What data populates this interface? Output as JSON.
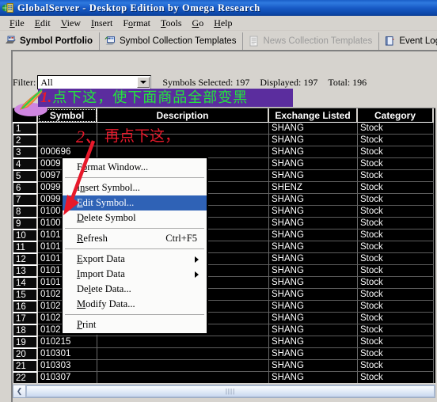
{
  "window": {
    "title": "GlobalServer - Desktop Edition by Omega Research",
    "icon": "application-icon"
  },
  "menubar": {
    "items": [
      {
        "label": "File",
        "accel": "F"
      },
      {
        "label": "Edit",
        "accel": "E"
      },
      {
        "label": "View",
        "accel": "V"
      },
      {
        "label": "Insert",
        "accel": "I"
      },
      {
        "label": "Format",
        "accel": "o"
      },
      {
        "label": "Tools",
        "accel": "T"
      },
      {
        "label": "Go",
        "accel": "G"
      },
      {
        "label": "Help",
        "accel": "H"
      }
    ]
  },
  "tabs": [
    {
      "label": "Symbol Portfolio",
      "icon": "portfolio-icon",
      "active": true,
      "disabled": false
    },
    {
      "label": "Symbol Collection Templates",
      "icon": "symbol-template-icon",
      "active": false,
      "disabled": false
    },
    {
      "label": "News Collection Templates",
      "icon": "news-template-icon",
      "active": false,
      "disabled": true
    },
    {
      "label": "Event Log",
      "icon": "event-log-icon",
      "active": false,
      "disabled": false
    }
  ],
  "filterbar": {
    "label": "Filter:",
    "combo_value": "All",
    "combo_placeholder": "All",
    "dropdown_icon": "chevron-down-icon",
    "stats": [
      "Symbols  Selected: 197",
      "Displayed: 197",
      "Total: 196"
    ]
  },
  "grid": {
    "columns": [
      "Symbol",
      "Description",
      "Exchange Listed",
      "Category"
    ],
    "rows": [
      {
        "n": "1",
        "symbol": "",
        "description": "",
        "exchange": "SHANG",
        "category": "Stock"
      },
      {
        "n": "2",
        "symbol": "",
        "description": "",
        "exchange": "SHANG",
        "category": "Stock"
      },
      {
        "n": "3",
        "symbol": "000696",
        "description": "",
        "exchange": "SHANG",
        "category": "Stock"
      },
      {
        "n": "4",
        "symbol": "0009",
        "description": "",
        "exchange": "SHANG",
        "category": "Stock"
      },
      {
        "n": "5",
        "symbol": "0097",
        "description": "",
        "exchange": "SHANG",
        "category": "Stock"
      },
      {
        "n": "6",
        "symbol": "0099",
        "description": "",
        "exchange": "SHENZ",
        "category": "Stock"
      },
      {
        "n": "7",
        "symbol": "0099",
        "description": "",
        "exchange": "SHANG",
        "category": "Stock"
      },
      {
        "n": "8",
        "symbol": "0100",
        "description": "",
        "exchange": "SHANG",
        "category": "Stock"
      },
      {
        "n": "9",
        "symbol": "0100",
        "description": "",
        "exchange": "SHANG",
        "category": "Stock"
      },
      {
        "n": "10",
        "symbol": "0101",
        "description": "",
        "exchange": "SHANG",
        "category": "Stock"
      },
      {
        "n": "11",
        "symbol": "0101",
        "description": "",
        "exchange": "SHANG",
        "category": "Stock"
      },
      {
        "n": "12",
        "symbol": "0101",
        "description": "",
        "exchange": "SHANG",
        "category": "Stock"
      },
      {
        "n": "13",
        "symbol": "0101",
        "description": "",
        "exchange": "SHANG",
        "category": "Stock"
      },
      {
        "n": "14",
        "symbol": "0101",
        "description": "",
        "exchange": "SHANG",
        "category": "Stock"
      },
      {
        "n": "15",
        "symbol": "0102",
        "description": "",
        "exchange": "SHANG",
        "category": "Stock"
      },
      {
        "n": "16",
        "symbol": "0102",
        "description": "",
        "exchange": "SHANG",
        "category": "Stock"
      },
      {
        "n": "17",
        "symbol": "0102",
        "description": "",
        "exchange": "SHANG",
        "category": "Stock"
      },
      {
        "n": "18",
        "symbol": "0102",
        "description": "",
        "exchange": "SHANG",
        "category": "Stock"
      },
      {
        "n": "19",
        "symbol": "010215",
        "description": "",
        "exchange": "SHANG",
        "category": "Stock"
      },
      {
        "n": "20",
        "symbol": "010301",
        "description": "",
        "exchange": "SHANG",
        "category": "Stock"
      },
      {
        "n": "21",
        "symbol": "010303",
        "description": "",
        "exchange": "SHANG",
        "category": "Stock"
      },
      {
        "n": "22",
        "symbol": "010307",
        "description": "",
        "exchange": "SHANG",
        "category": "Stock"
      }
    ]
  },
  "context_menu": {
    "items": [
      {
        "kind": "item",
        "label": "Format Window...",
        "accel_char": "o",
        "shortcut": "",
        "submenu": false,
        "selected": false
      },
      {
        "kind": "separator"
      },
      {
        "kind": "item",
        "label": "Insert Symbol...",
        "accel_char": "n",
        "shortcut": "",
        "submenu": false,
        "selected": false
      },
      {
        "kind": "item",
        "label": "Edit Symbol...",
        "accel_char": "E",
        "shortcut": "",
        "submenu": false,
        "selected": true
      },
      {
        "kind": "item",
        "label": "Delete Symbol",
        "accel_char": "D",
        "shortcut": "",
        "submenu": false,
        "selected": false
      },
      {
        "kind": "separator"
      },
      {
        "kind": "item",
        "label": "Refresh",
        "accel_char": "R",
        "shortcut": "Ctrl+F5",
        "submenu": false,
        "selected": false
      },
      {
        "kind": "separator"
      },
      {
        "kind": "item",
        "label": "Export Data",
        "accel_char": "E",
        "shortcut": "",
        "submenu": true,
        "selected": false
      },
      {
        "kind": "item",
        "label": "Import Data",
        "accel_char": "I",
        "shortcut": "",
        "submenu": true,
        "selected": false
      },
      {
        "kind": "item",
        "label": "Delete Data...",
        "accel_char": "l",
        "shortcut": "",
        "submenu": false,
        "selected": false
      },
      {
        "kind": "item",
        "label": "Modify Data...",
        "accel_char": "M",
        "shortcut": "",
        "submenu": false,
        "selected": false
      },
      {
        "kind": "separator"
      },
      {
        "kind": "item",
        "label": "Print",
        "accel_char": "P",
        "shortcut": "",
        "submenu": false,
        "selected": false
      }
    ]
  },
  "scrollbar": {
    "left_arrow": "chevron-left-icon",
    "thumb_grip": "grip-icon"
  },
  "annotations": {
    "step1_number": "1.",
    "step1_text": "点下这，使下面商品全部变黑",
    "step2_number": "2、",
    "step2_text": "再点下这，",
    "cursor_icon": "hand-pointer-icon",
    "highlight_ellipse": "select-all-highlight",
    "arrow_icon": "red-arrow-icon",
    "colors": {
      "banner_background": "#5b2d9e",
      "banner_text": "#22e83a",
      "step_number": "#e8192b",
      "ellipse": "#cf86e0",
      "cursor": "#f59a4b"
    }
  }
}
